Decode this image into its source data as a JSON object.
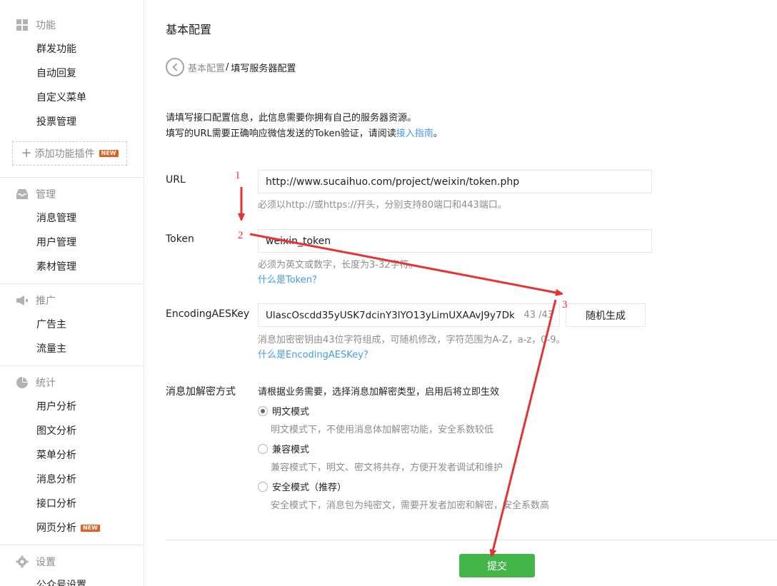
{
  "sidebar": {
    "sections": [
      {
        "title": "功能",
        "icon": "grid-icon",
        "items": [
          {
            "label": "群发功能"
          },
          {
            "label": "自动回复"
          },
          {
            "label": "自定义菜单"
          },
          {
            "label": "投票管理"
          }
        ],
        "add_plugin": "添加功能插件",
        "add_plugin_badge": "NEW"
      },
      {
        "title": "管理",
        "icon": "inbox-icon",
        "items": [
          {
            "label": "消息管理"
          },
          {
            "label": "用户管理"
          },
          {
            "label": "素材管理"
          }
        ]
      },
      {
        "title": "推广",
        "icon": "megaphone-icon",
        "items": [
          {
            "label": "广告主"
          },
          {
            "label": "流量主"
          }
        ]
      },
      {
        "title": "统计",
        "icon": "pie-chart-icon",
        "items": [
          {
            "label": "用户分析"
          },
          {
            "label": "图文分析"
          },
          {
            "label": "菜单分析"
          },
          {
            "label": "消息分析"
          },
          {
            "label": "接口分析"
          },
          {
            "label": "网页分析",
            "badge": "NEW"
          }
        ]
      },
      {
        "title": "设置",
        "icon": "gear-icon",
        "items": [
          {
            "label": "公众号设置"
          }
        ]
      }
    ]
  },
  "main": {
    "page_title": "基本配置",
    "breadcrumb": {
      "parent": "基本配置",
      "separator": "/",
      "current": "填写服务器配置"
    },
    "intro_line1": "请填写接口配置信息，此信息需要你拥有自己的服务器资源。",
    "intro_line2_prefix": "填写的URL需要正确响应微信发送的Token验证，请阅读",
    "intro_link": "接入指南",
    "intro_line2_suffix": "。",
    "url": {
      "label": "URL",
      "value": "http://www.sucaihuo.com/project/weixin/token.php",
      "hint": "必须以http://或https://开头，分别支持80端口和443端口。"
    },
    "token": {
      "label": "Token",
      "value": "weixin_token",
      "hint": "必须为英文或数字，长度为3-32字符。",
      "link": "什么是Token？"
    },
    "aeskey": {
      "label": "EncodingAESKey",
      "value": "UlascOscdd35yUSK7dcinY3lYO13yLimUXAAvJ9y7Dk",
      "count": "43 /43",
      "button": "随机生成",
      "hint": "消息加密密钥由43位字符组成，可随机修改，字符范围为A-Z，a-z，0-9。",
      "link": "什么是EncodingAESKey？"
    },
    "encrypt": {
      "label": "消息加解密方式",
      "desc": "请根据业务需要，选择消息加解密类型，启用后将立即生效",
      "options": [
        {
          "label": "明文模式",
          "desc": "明文模式下，不使用消息体加解密功能，安全系数较低",
          "checked": true
        },
        {
          "label": "兼容模式",
          "desc": "兼容模式下，明文、密文将共存，方便开发者调试和维护",
          "checked": false
        },
        {
          "label": "安全模式（推荐）",
          "desc": "安全模式下，消息包为纯密文，需要开发者加密和解密，安全系数高",
          "checked": false
        }
      ]
    },
    "submit": "提交"
  },
  "annotations": {
    "step1": "1",
    "step2": "2",
    "step3": "3",
    "arrow_color": "#e53333"
  }
}
